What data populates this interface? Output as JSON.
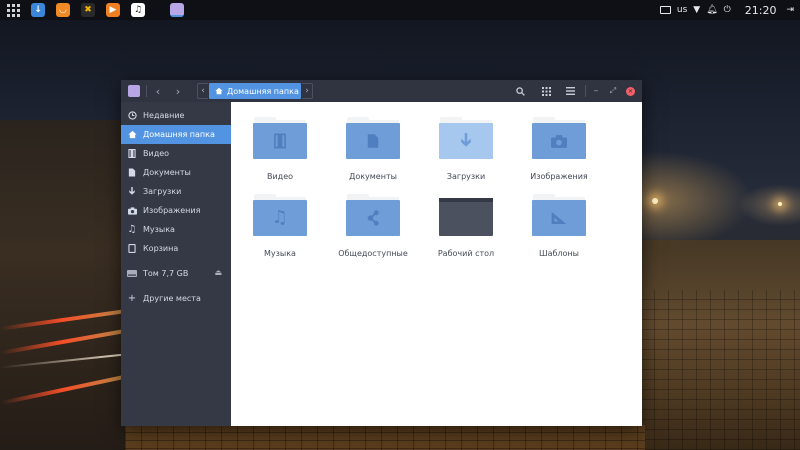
{
  "panel": {
    "apps": [
      "download-app",
      "files-app",
      "media-app",
      "player-app",
      "music-app",
      "image-viewer-app"
    ],
    "keyboard_layout": "us",
    "clock": "21:20"
  },
  "window": {
    "breadcrumb": "Домашняя папка"
  },
  "sidebar": {
    "items": [
      {
        "label": "Недавние",
        "icon": "clock-icon"
      },
      {
        "label": "Домашняя папка",
        "icon": "home-icon",
        "active": true
      },
      {
        "label": "Видео",
        "icon": "film-icon"
      },
      {
        "label": "Документы",
        "icon": "document-icon"
      },
      {
        "label": "Загрузки",
        "icon": "download-icon"
      },
      {
        "label": "Изображения",
        "icon": "camera-icon"
      },
      {
        "label": "Музыка",
        "icon": "music-note-icon"
      },
      {
        "label": "Корзина",
        "icon": "trash-icon"
      }
    ],
    "volume": {
      "label": "Том 7,7 GB",
      "icon": "drive-icon"
    },
    "other": {
      "label": "Другие места",
      "icon": "plus-icon"
    }
  },
  "folders": [
    {
      "label": "Видео",
      "emblem": "film-icon"
    },
    {
      "label": "Документы",
      "emblem": "document-icon"
    },
    {
      "label": "Загрузки",
      "emblem": "download-arrow-icon"
    },
    {
      "label": "Изображения",
      "emblem": "camera-icon"
    },
    {
      "label": "Музыка",
      "emblem": "music-note-icon"
    },
    {
      "label": "Общедоступные",
      "emblem": "share-icon"
    },
    {
      "label": "Рабочий стол",
      "emblem": "desktop-icon"
    },
    {
      "label": "Шаблоны",
      "emblem": "ruler-triangle-icon"
    }
  ],
  "colors": {
    "accent": "#5294e2",
    "folder": "#6f9dd8",
    "sidebar": "#353945",
    "titlebar": "#2f3440",
    "close": "#f46067"
  }
}
